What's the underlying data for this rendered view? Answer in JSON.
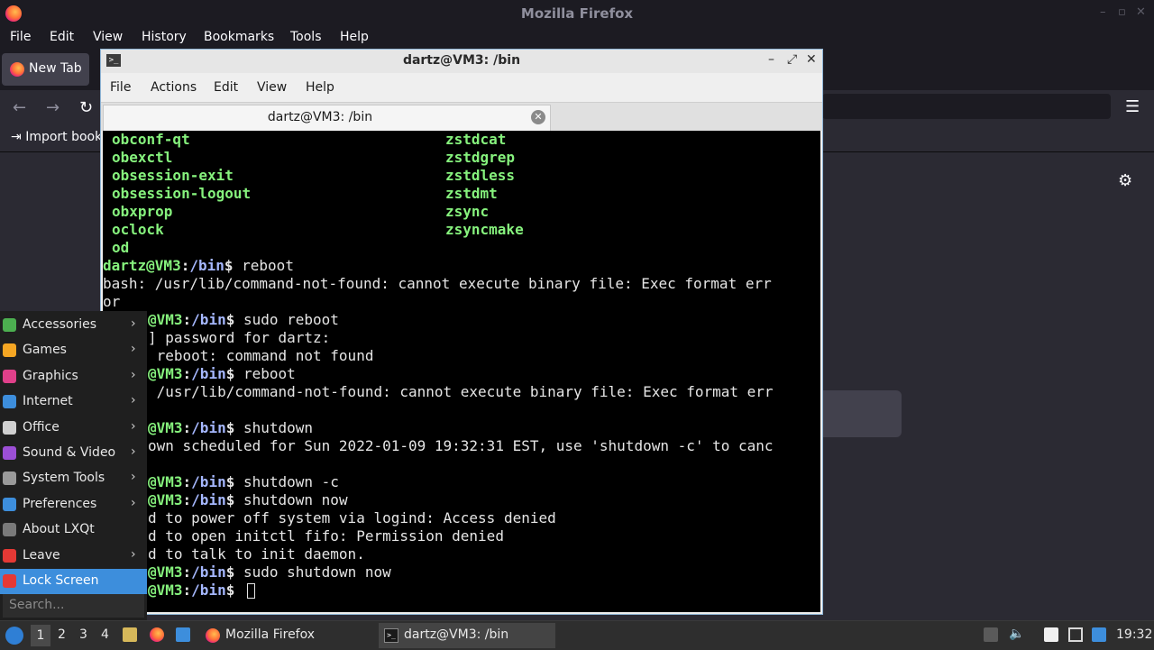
{
  "firefox": {
    "window_title": "Mozilla Firefox",
    "menu": [
      "File",
      "Edit",
      "View",
      "History",
      "Bookmarks",
      "Tools",
      "Help"
    ],
    "tab_label": "New Tab",
    "bookmarks_label": "Import book",
    "accent": "#ff7139"
  },
  "terminal": {
    "window_title": "dartz@VM3: /bin",
    "menu": [
      "File",
      "Actions",
      "Edit",
      "View",
      "Help"
    ],
    "tab_label": "dartz@VM3: /bin",
    "prompt_user": "dartz@VM3",
    "prompt_path": "/bin",
    "colors": {
      "executable": "#86f27d",
      "path": "#a6b8ff",
      "text": "#e5e5e5",
      "background": "#000000"
    },
    "file_list": {
      "col1": [
        "obconf-qt",
        "obexctl",
        "obsession-exit",
        "obsession-logout",
        "obxprop",
        "oclock",
        "od"
      ],
      "col2": [
        "zstdcat",
        "zstdgrep",
        "zstdless",
        "zstdmt",
        "zsync",
        "zsyncmake"
      ]
    },
    "lines": [
      {
        "user": "dartz@VM3",
        "path": "/bin",
        "cmd": " reboot"
      },
      {
        "text": "bash: /usr/lib/command-not-found: cannot execute binary file: Exec format err"
      },
      {
        "text": "or"
      },
      {
        "user": "@VM3",
        "path": "/bin",
        "cmd": " sudo reboot"
      },
      {
        "text": "] password for dartz:"
      },
      {
        "text": " reboot: command not found"
      },
      {
        "user": "@VM3",
        "path": "/bin",
        "cmd": " reboot"
      },
      {
        "text": " /usr/lib/command-not-found: cannot execute binary file: Exec format err"
      },
      {
        "text": ""
      },
      {
        "user": "@VM3",
        "path": "/bin",
        "cmd": " shutdown"
      },
      {
        "text": "own scheduled for Sun 2022-01-09 19:32:31 EST, use 'shutdown -c' to canc"
      },
      {
        "text": ""
      },
      {
        "user": "@VM3",
        "path": "/bin",
        "cmd": " shutdown -c"
      },
      {
        "user": "@VM3",
        "path": "/bin",
        "cmd": " shutdown now"
      },
      {
        "text": "d to power off system via logind: Access denied"
      },
      {
        "text": "d to open initctl fifo: Permission denied"
      },
      {
        "text": "d to talk to init daemon."
      },
      {
        "user": "@VM3",
        "path": "/bin",
        "cmd": " sudo shutdown now"
      },
      {
        "user": "@VM3",
        "path": "/bin",
        "cmd": " "
      }
    ]
  },
  "start_menu": {
    "items": [
      {
        "label": "Accessories",
        "icon": "accessories-icon",
        "color": "#4caf50",
        "submenu": true
      },
      {
        "label": "Games",
        "icon": "games-icon",
        "color": "#f5a623",
        "submenu": true
      },
      {
        "label": "Graphics",
        "icon": "graphics-icon",
        "color": "#e0408a",
        "submenu": true
      },
      {
        "label": "Internet",
        "icon": "internet-icon",
        "color": "#3d8edc",
        "submenu": true
      },
      {
        "label": "Office",
        "icon": "office-icon",
        "color": "#d0d0d0",
        "submenu": true
      },
      {
        "label": "Sound & Video",
        "icon": "sound-video-icon",
        "color": "#9c4fd6",
        "submenu": true
      },
      {
        "label": "System Tools",
        "icon": "system-tools-icon",
        "color": "#9a9a9a",
        "submenu": true
      },
      {
        "label": "Preferences",
        "icon": "preferences-icon",
        "color": "#3d8edc",
        "submenu": true
      },
      {
        "label": "About LXQt",
        "icon": "info-icon",
        "color": "#7a7a7a",
        "submenu": false
      },
      {
        "label": "Leave",
        "icon": "power-icon",
        "color": "#e53935",
        "submenu": true
      },
      {
        "label": "Lock Screen",
        "icon": "lock-icon",
        "color": "#e53935",
        "submenu": false
      }
    ],
    "selected": "Lock Screen",
    "search_placeholder": "Search..."
  },
  "taskbar": {
    "workspaces": [
      "1",
      "2",
      "3",
      "4"
    ],
    "active_workspace": "1",
    "tasks": [
      {
        "label": "Mozilla Firefox",
        "icon": "firefox-icon"
      },
      {
        "label": "dartz@VM3: /bin",
        "icon": "terminal-icon"
      }
    ],
    "clock": "19:32"
  }
}
